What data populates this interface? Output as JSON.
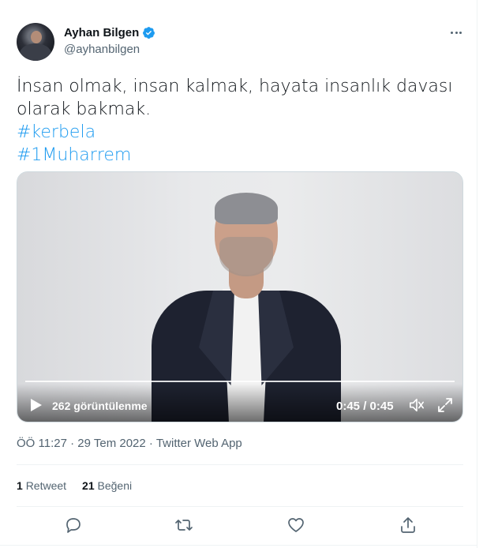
{
  "author": {
    "name": "Ayhan Bilgen",
    "handle": "@ayhanbilgen",
    "verified": true
  },
  "tweet": {
    "text_line1": "İnsan olmak, insan kalmak, hayata insanlık davası",
    "text_line2": "olarak bakmak.",
    "hashtags": [
      "#kerbela",
      "#1Muharrem"
    ]
  },
  "video": {
    "views": "262 görüntülenme",
    "time": "0:45 / 0:45",
    "progress": 1.0
  },
  "meta": {
    "time": "ÖÖ 11:27",
    "sep1": " · ",
    "date": "29 Tem 2022",
    "sep2": " · ",
    "source": "Twitter Web App"
  },
  "stats": {
    "retweets_count": "1",
    "retweets_label": "Retweet",
    "likes_count": "21",
    "likes_label": "Beğeni"
  },
  "icons": {
    "verified": "verified-badge-icon",
    "more": "more-icon",
    "play": "play-icon",
    "volume": "volume-icon",
    "fullscreen": "fullscreen-icon",
    "reply": "reply-icon",
    "retweet": "retweet-icon",
    "like": "like-icon",
    "share": "share-icon"
  },
  "colors": {
    "accent": "#1d9bf0",
    "text": "#0f1419",
    "secondary": "#536471"
  }
}
